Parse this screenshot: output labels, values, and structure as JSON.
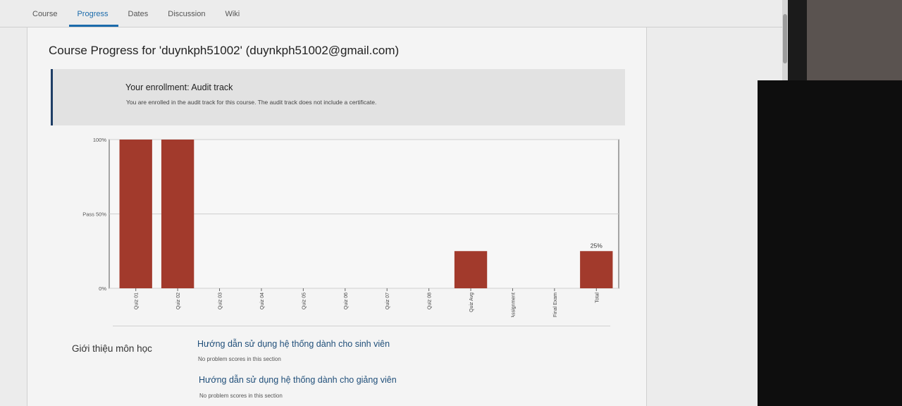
{
  "nav": {
    "tabs": [
      {
        "label": "Course"
      },
      {
        "label": "Progress"
      },
      {
        "label": "Dates"
      },
      {
        "label": "Discussion"
      },
      {
        "label": "Wiki"
      }
    ],
    "active_index": 1
  },
  "page": {
    "title": "Course Progress for 'duynkph51002' (duynkph51002@gmail.com)"
  },
  "enrollment": {
    "title": "Your enrollment: Audit track",
    "description": "You are enrolled in the audit track for this course. The audit track does not include a certificate."
  },
  "colors": {
    "bar": "#a23a2c",
    "accent": "#1b6bab"
  },
  "chart_data": {
    "type": "bar",
    "categories": [
      "Quiz 01",
      "Quiz 02",
      "Quiz 03",
      "Quiz 04",
      "Quiz 05",
      "Quiz 06",
      "Quiz 07",
      "Quiz 08",
      "Quiz Avg",
      "Assignment",
      "Final Exam",
      "Total"
    ],
    "values": [
      100,
      100,
      0,
      0,
      0,
      0,
      0,
      0,
      25,
      0,
      0,
      25
    ],
    "y_ticks": [
      {
        "value": 100,
        "label": "100%"
      },
      {
        "value": 50,
        "label": "Pass 50%"
      },
      {
        "value": 0,
        "label": "0%"
      }
    ],
    "data_labels": [
      {
        "index": 11,
        "label": "25%"
      }
    ],
    "ylim": [
      0,
      100
    ],
    "title": "",
    "xlabel": "",
    "ylabel": ""
  },
  "chapters": [
    {
      "title": "Giới thiệu môn học",
      "sections": [
        {
          "title": "Hướng dẫn sử dụng hệ thống dành cho sinh viên",
          "note": "No problem scores in this section"
        },
        {
          "title": "Hướng dẫn sử dụng hệ thống dành cho giảng viên",
          "note": "No problem scores in this section"
        }
      ]
    }
  ]
}
